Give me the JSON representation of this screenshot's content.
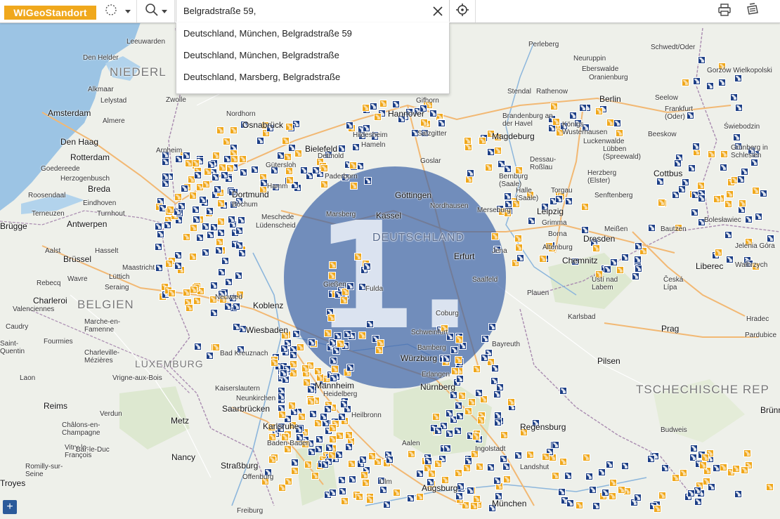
{
  "app": {
    "title": "WIGeoStandort"
  },
  "search": {
    "value": "Belgradstraße 59,",
    "suggestions": [
      "Deutschland, München, Belgradstraße 59",
      "Deutschland, München, Belgradstraße",
      "Deutschland, Marsberg, Belgradstraße"
    ]
  },
  "map": {
    "badge_text": "1.",
    "countries": [
      "NIEDERL",
      "BELGIEN",
      "LUXEMBURG",
      "DEUTSCHLAND",
      "TSCHECHISCHE REP"
    ],
    "cities": [
      {
        "name": "Leeuwarden"
      },
      {
        "name": "Den Helder"
      },
      {
        "name": "Alkmaar"
      },
      {
        "name": "Lelystad"
      },
      {
        "name": "Amsterdam"
      },
      {
        "name": "Almere"
      },
      {
        "name": "Zwolle"
      },
      {
        "name": "Nordhorn"
      },
      {
        "name": "Den Haag"
      },
      {
        "name": "Rotterdam"
      },
      {
        "name": "Goedereede"
      },
      {
        "name": "Herzogenbusch"
      },
      {
        "name": "Breda"
      },
      {
        "name": "Arnheim"
      },
      {
        "name": "Roosendaal"
      },
      {
        "name": "Eindhoven"
      },
      {
        "name": "Terneuzen"
      },
      {
        "name": "Turnhout"
      },
      {
        "name": "Brügge"
      },
      {
        "name": "Antwerpen"
      },
      {
        "name": "Aalst"
      },
      {
        "name": "Hasselt"
      },
      {
        "name": "Brüssel"
      },
      {
        "name": "Maastricht"
      },
      {
        "name": "Wavre"
      },
      {
        "name": "Lüttich"
      },
      {
        "name": "Seraing"
      },
      {
        "name": "Rebecq"
      },
      {
        "name": "Charleroi"
      },
      {
        "name": "Valenciennes"
      },
      {
        "name": "Caudry"
      },
      {
        "name": "Saint-Quentin"
      },
      {
        "name": "Fourmies"
      },
      {
        "name": "Marche-en-Famenne"
      },
      {
        "name": "Charleville-Mézières"
      },
      {
        "name": "Laon"
      },
      {
        "name": "Vrigne-aux-Bois"
      },
      {
        "name": "Reims"
      },
      {
        "name": "Verdun"
      },
      {
        "name": "Châlons-en-Champagne"
      },
      {
        "name": "Metz"
      },
      {
        "name": "Vitry-le-François"
      },
      {
        "name": "Bar-le-Duc"
      },
      {
        "name": "Nancy"
      },
      {
        "name": "Romilly-sur-Seine"
      },
      {
        "name": "Troyes"
      },
      {
        "name": "Straßburg"
      },
      {
        "name": "Offenburg"
      },
      {
        "name": "Freiburg"
      },
      {
        "name": "Kaiserslautern"
      },
      {
        "name": "Neunkirchen"
      },
      {
        "name": "Saarbrücken"
      },
      {
        "name": "Karlsruhe"
      },
      {
        "name": "Baden-Baden"
      },
      {
        "name": "Bad Kreuznach"
      },
      {
        "name": "Wiesbaden"
      },
      {
        "name": "Neuwied"
      },
      {
        "name": "Koblenz"
      },
      {
        "name": "Dortmund"
      },
      {
        "name": "Bochum"
      },
      {
        "name": "Hamm"
      },
      {
        "name": "Gütersloh"
      },
      {
        "name": "Bielefeld"
      },
      {
        "name": "Detmold"
      },
      {
        "name": "Paderborn"
      },
      {
        "name": "Osnabrück"
      },
      {
        "name": "Hameln"
      },
      {
        "name": "Hildesheim"
      },
      {
        "name": "Hannover"
      },
      {
        "name": "Salzgitter"
      },
      {
        "name": "Gifhorn"
      },
      {
        "name": "Goslar"
      },
      {
        "name": "Göttingen"
      },
      {
        "name": "Nordhausen"
      },
      {
        "name": "Meschede"
      },
      {
        "name": "Lüdenscheid"
      },
      {
        "name": "Marsberg"
      },
      {
        "name": "Kassel"
      },
      {
        "name": "Gießen"
      },
      {
        "name": "Fulda"
      },
      {
        "name": "Erfurt"
      },
      {
        "name": "Jena"
      },
      {
        "name": "Saalfeld"
      },
      {
        "name": "Plauen"
      },
      {
        "name": "Coburg"
      },
      {
        "name": "Schweinfurt"
      },
      {
        "name": "Bamberg"
      },
      {
        "name": "Bayreuth"
      },
      {
        "name": "Würzburg"
      },
      {
        "name": "Erlangen"
      },
      {
        "name": "Nürnberg"
      },
      {
        "name": "Mannheim"
      },
      {
        "name": "Heidelberg"
      },
      {
        "name": "Heilbronn"
      },
      {
        "name": "Aalen"
      },
      {
        "name": "Ulm"
      },
      {
        "name": "Augsburg"
      },
      {
        "name": "München"
      },
      {
        "name": "Ingolstadt"
      },
      {
        "name": "Regensburg"
      },
      {
        "name": "Landshut"
      },
      {
        "name": "Magdeburg"
      },
      {
        "name": "Halle (Saale)"
      },
      {
        "name": "Leipzig"
      },
      {
        "name": "Merseburg"
      },
      {
        "name": "Torgau"
      },
      {
        "name": "Grimma"
      },
      {
        "name": "Borna"
      },
      {
        "name": "Altenburg"
      },
      {
        "name": "Chemnitz"
      },
      {
        "name": "Dresden"
      },
      {
        "name": "Meißen"
      },
      {
        "name": "Bautzen"
      },
      {
        "name": "Dessau-Roßlau"
      },
      {
        "name": "Bernburg (Saale)"
      },
      {
        "name": "Berlin"
      },
      {
        "name": "Brandenburg an der Havel"
      },
      {
        "name": "Stendal"
      },
      {
        "name": "Rathenow"
      },
      {
        "name": "Neuruppin"
      },
      {
        "name": "Perleberg"
      },
      {
        "name": "Eberswalde"
      },
      {
        "name": "Oranienburg"
      },
      {
        "name": "Königs Wusterhausen"
      },
      {
        "name": "Luckenwalde"
      },
      {
        "name": "Lübben (Spreewald)"
      },
      {
        "name": "Herzberg (Elster)"
      },
      {
        "name": "Senftenberg"
      },
      {
        "name": "Cottbus"
      },
      {
        "name": "Frankfurt (Oder)"
      },
      {
        "name": "Beeskow"
      },
      {
        "name": "Seelow"
      },
      {
        "name": "Schwedt/Oder"
      },
      {
        "name": "Gorzów Wielkopolski"
      },
      {
        "name": "Świebodzin"
      },
      {
        "name": "Grünberg in Schlesien"
      },
      {
        "name": "Bolesławiec"
      },
      {
        "name": "Jelenia Góra"
      },
      {
        "name": "Wałbrzych"
      },
      {
        "name": "Liberec"
      },
      {
        "name": "Ústí nad Labem"
      },
      {
        "name": "Česká Lípa"
      },
      {
        "name": "Prag"
      },
      {
        "name": "Karlsbad"
      },
      {
        "name": "Pilsen"
      },
      {
        "name": "Budweis"
      },
      {
        "name": "Pardubice"
      },
      {
        "name": "Brünn"
      },
      {
        "name": "Hradec"
      }
    ]
  },
  "colors": {
    "accent": "#f0a81c",
    "marker_blue": "#1d3f86",
    "badge_blue": "#3c63a6"
  }
}
